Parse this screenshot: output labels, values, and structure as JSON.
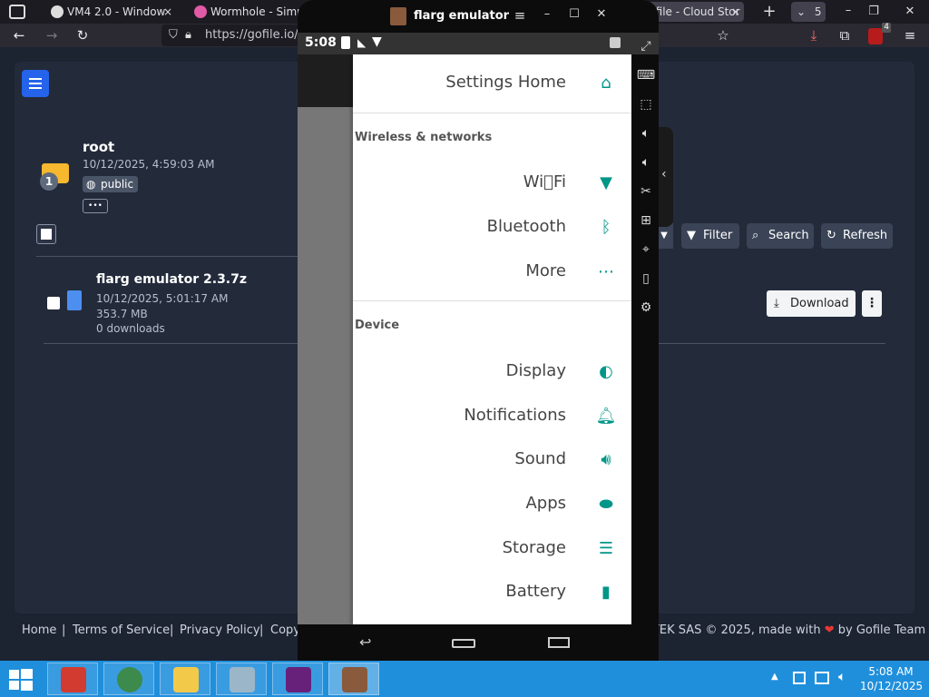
{
  "browser": {
    "tabs": [
      {
        "label": "VM4 2.0 - Window",
        "close": "×"
      },
      {
        "label": "Wormhole - Simpl",
        "close": ""
      },
      {
        "label": "Gofile - Cloud Stor",
        "close": "×"
      }
    ],
    "tab_count": "5",
    "url": "https://gofile.io/d",
    "ext_badge": "4"
  },
  "gofile": {
    "folder": {
      "name": "root",
      "date": "10/12/2025, 4:59:03 AM",
      "badge_count": "1",
      "visibility": "public",
      "more_label": "•••"
    },
    "toolbar": {
      "filter_label": "Filter",
      "search_label": "Search",
      "refresh_label": "Refresh"
    },
    "files": [
      {
        "name": "flarg emulator 2.3.7z",
        "date": "10/12/2025, 5:01:17 AM",
        "size": "353.7 MB",
        "downloads": "0 downloads",
        "download_label": "Download"
      }
    ],
    "footer": {
      "home": "Home",
      "tos": "Terms of Service",
      "privacy": "Privacy Policy",
      "copy": "Copy",
      "credit": "WOJTEK SAS © 2025, made with",
      "by": "by Gofile Team",
      "heart": "❤"
    }
  },
  "emulator": {
    "title": "flarg emulator",
    "time": "5:08",
    "drawer": {
      "header": "Settings Home",
      "sections": [
        {
          "label": "Wireless & networks",
          "items": [
            "Wi\u0000Fi",
            "Bluetooth",
            "More"
          ]
        },
        {
          "label": "Device",
          "items": [
            "Display",
            "Notifications",
            "Sound",
            "Apps",
            "Storage",
            "Battery"
          ]
        }
      ]
    }
  },
  "taskbar": {
    "time": "5:08 AM",
    "date": "10/12/2025"
  },
  "colors": {
    "accent_teal": "#009688",
    "gofile_blue": "#2563eb",
    "taskbar_blue": "#1f8fdc"
  }
}
